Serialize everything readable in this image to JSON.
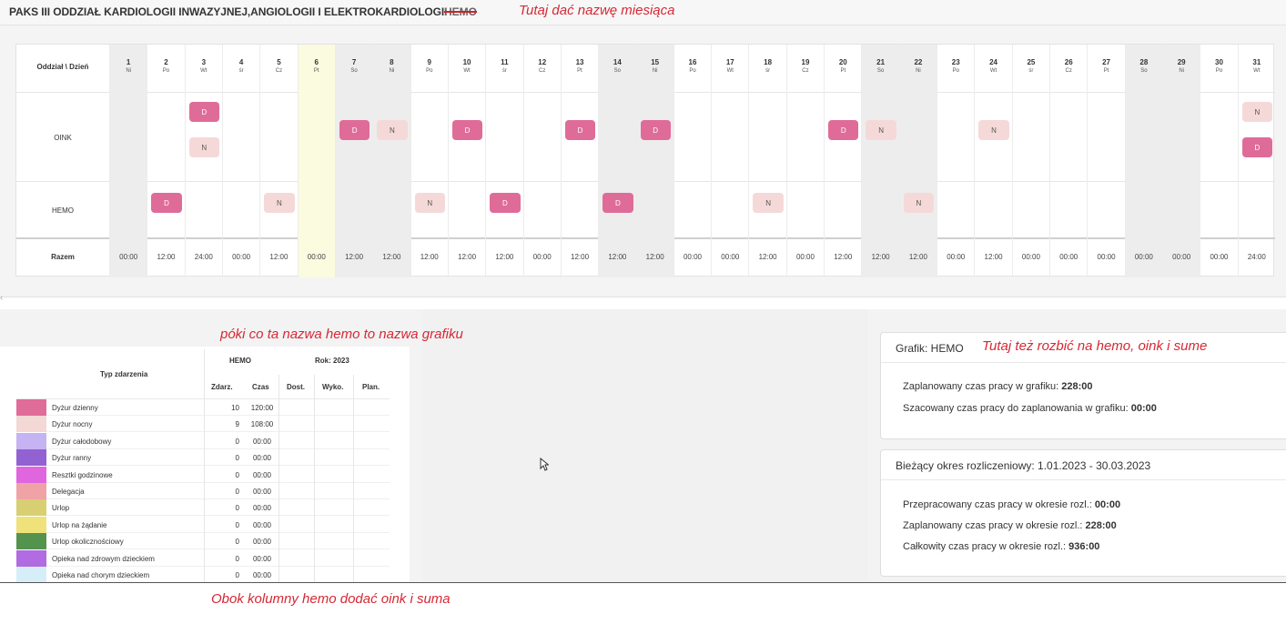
{
  "header": {
    "title": "PAKS III ODDZIAŁ KARDIOLOGII INWAZYJNEJ,ANGIOLOGII I ELEKTROKARDIOLOGII",
    "title_struck": "HEMO"
  },
  "annotations": {
    "month": "Tutaj dać nazwę miesiąca",
    "schedule_name": "póki co ta nazwa hemo to nazwa grafiku",
    "split": "Tutaj też rozbić na hemo, oink i sume",
    "columns": "Obok kolumny hemo dodać oink i suma"
  },
  "schedule": {
    "corner_label": "Oddział \\ Dzień",
    "rows": [
      "OINK",
      "HEMO"
    ],
    "total_label": "Razem",
    "days": [
      {
        "num": "1",
        "name": "Ni",
        "total": "00:00",
        "oink": [],
        "hemo": []
      },
      {
        "num": "2",
        "name": "Po",
        "total": "12:00",
        "oink": [],
        "hemo": [
          "D"
        ]
      },
      {
        "num": "3",
        "name": "Wt",
        "total": "24:00",
        "oink": [
          "D",
          "N"
        ],
        "hemo": []
      },
      {
        "num": "4",
        "name": "śr",
        "total": "00:00",
        "oink": [],
        "hemo": []
      },
      {
        "num": "5",
        "name": "Cz",
        "total": "12:00",
        "oink": [],
        "hemo": [
          "N"
        ]
      },
      {
        "num": "6",
        "name": "Pt",
        "total": "00:00",
        "oink": [],
        "hemo": []
      },
      {
        "num": "7",
        "name": "So",
        "total": "12:00",
        "oink": [
          "D"
        ],
        "hemo": []
      },
      {
        "num": "8",
        "name": "Ni",
        "total": "12:00",
        "oink": [
          "N"
        ],
        "hemo": []
      },
      {
        "num": "9",
        "name": "Po",
        "total": "12:00",
        "oink": [],
        "hemo": [
          "N"
        ]
      },
      {
        "num": "10",
        "name": "Wt",
        "total": "12:00",
        "oink": [
          "D"
        ],
        "hemo": []
      },
      {
        "num": "11",
        "name": "śr",
        "total": "12:00",
        "oink": [],
        "hemo": [
          "D"
        ]
      },
      {
        "num": "12",
        "name": "Cz",
        "total": "00:00",
        "oink": [],
        "hemo": []
      },
      {
        "num": "13",
        "name": "Pt",
        "total": "12:00",
        "oink": [
          "D"
        ],
        "hemo": []
      },
      {
        "num": "14",
        "name": "So",
        "total": "12:00",
        "oink": [],
        "hemo": [
          "D"
        ]
      },
      {
        "num": "15",
        "name": "Ni",
        "total": "12:00",
        "oink": [
          "D"
        ],
        "hemo": []
      },
      {
        "num": "16",
        "name": "Po",
        "total": "00:00",
        "oink": [],
        "hemo": []
      },
      {
        "num": "17",
        "name": "Wt",
        "total": "00:00",
        "oink": [],
        "hemo": []
      },
      {
        "num": "18",
        "name": "śr",
        "total": "12:00",
        "oink": [],
        "hemo": [
          "N"
        ]
      },
      {
        "num": "19",
        "name": "Cz",
        "total": "00:00",
        "oink": [],
        "hemo": []
      },
      {
        "num": "20",
        "name": "Pt",
        "total": "12:00",
        "oink": [
          "D"
        ],
        "hemo": []
      },
      {
        "num": "21",
        "name": "So",
        "total": "12:00",
        "oink": [
          "N"
        ],
        "hemo": []
      },
      {
        "num": "22",
        "name": "Ni",
        "total": "12:00",
        "oink": [],
        "hemo": [
          "N"
        ]
      },
      {
        "num": "23",
        "name": "Po",
        "total": "00:00",
        "oink": [],
        "hemo": []
      },
      {
        "num": "24",
        "name": "Wt",
        "total": "12:00",
        "oink": [
          "N"
        ],
        "hemo": []
      },
      {
        "num": "25",
        "name": "śr",
        "total": "00:00",
        "oink": [],
        "hemo": []
      },
      {
        "num": "26",
        "name": "Cz",
        "total": "00:00",
        "oink": [],
        "hemo": []
      },
      {
        "num": "27",
        "name": "Pt",
        "total": "00:00",
        "oink": [],
        "hemo": []
      },
      {
        "num": "28",
        "name": "So",
        "total": "00:00",
        "oink": [],
        "hemo": []
      },
      {
        "num": "29",
        "name": "Ni",
        "total": "00:00",
        "oink": [],
        "hemo": []
      },
      {
        "num": "30",
        "name": "Po",
        "total": "00:00",
        "oink": [],
        "hemo": []
      },
      {
        "num": "31",
        "name": "Wt",
        "total": "24:00",
        "oink": [
          "N",
          "D"
        ],
        "hemo": []
      }
    ]
  },
  "legend": {
    "type_header": "Typ zdarzenia",
    "group_hemo": "HEMO",
    "group_year": "Rok: 2023",
    "col_events": "Zdarz.",
    "col_time": "Czas",
    "col_dost": "Dost.",
    "col_wyko": "Wyko.",
    "col_plan": "Plan.",
    "items": [
      {
        "name": "Dyżur dzienny",
        "color": "#e06c99",
        "count": "10",
        "time": "120:00"
      },
      {
        "name": "Dyżur nocny",
        "color": "#f3d8d6",
        "count": "9",
        "time": "108:00"
      },
      {
        "name": "Dyżur całodobowy",
        "color": "#c5b3f3",
        "count": "0",
        "time": "00:00"
      },
      {
        "name": "Dyżur ranny",
        "color": "#9262d3",
        "count": "0",
        "time": "00:00"
      },
      {
        "name": "Resztki godzinowe",
        "color": "#df66df",
        "count": "0",
        "time": "00:00"
      },
      {
        "name": "Delegacja",
        "color": "#efa3a6",
        "count": "0",
        "time": "00:00"
      },
      {
        "name": "Urlop",
        "color": "#d8cf72",
        "count": "0",
        "time": "00:00"
      },
      {
        "name": "Urlop na żądanie",
        "color": "#efe27a",
        "count": "0",
        "time": "00:00"
      },
      {
        "name": "Urlop okolicznościowy",
        "color": "#54934e",
        "count": "0",
        "time": "00:00"
      },
      {
        "name": "Opieka nad zdrowym dzieckiem",
        "color": "#b06ce0",
        "count": "0",
        "time": "00:00"
      },
      {
        "name": "Opieka nad chorym dzieckiem",
        "color": "#d6eef7",
        "count": "0",
        "time": "00:00"
      }
    ]
  },
  "card_grafik": {
    "title": "Grafik: HEMO",
    "planned_label": "Zaplanowany czas pracy w grafiku:",
    "planned_value": "228:00",
    "estimated_label": "Szacowany czas pracy do zaplanowania w grafiku:",
    "estimated_value": "00:00"
  },
  "card_period": {
    "title": "Bieżący okres rozliczeniowy: 1.01.2023 - 30.03.2023",
    "worked_label": "Przepracowany czas pracy w okresie rozl.:",
    "worked_value": "00:00",
    "planned_label": "Zaplanowany czas pracy w okresie rozl.:",
    "planned_value": "228:00",
    "total_label": "Całkowity czas pracy w okresie rozl.:",
    "total_value": "936:00"
  }
}
